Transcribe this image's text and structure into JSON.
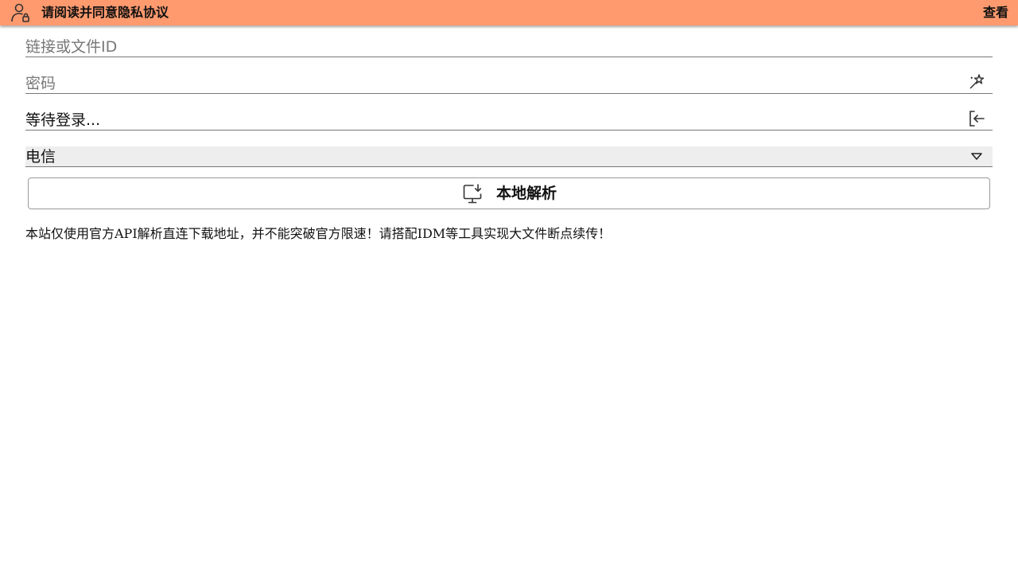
{
  "notice": {
    "icon": "user-lock-icon",
    "text": "请阅读并同意隐私协议",
    "action": "查看",
    "background": "#ff9a6e"
  },
  "form": {
    "link": {
      "placeholder": "链接或文件ID",
      "value": ""
    },
    "password": {
      "placeholder": "密码",
      "value": "",
      "icon": "magic-wand-icon"
    },
    "login": {
      "status": "等待登录...",
      "icon": "login-icon"
    },
    "isp": {
      "selected": "电信",
      "icon": "chevron-down-icon"
    },
    "parse_button": {
      "label": "本地解析",
      "icon": "monitor-download-icon"
    }
  },
  "disclaimer": "本站仅使用官方API解析直连下载地址，并不能突破官方限速！请搭配IDM等工具实现大文件断点续传！"
}
